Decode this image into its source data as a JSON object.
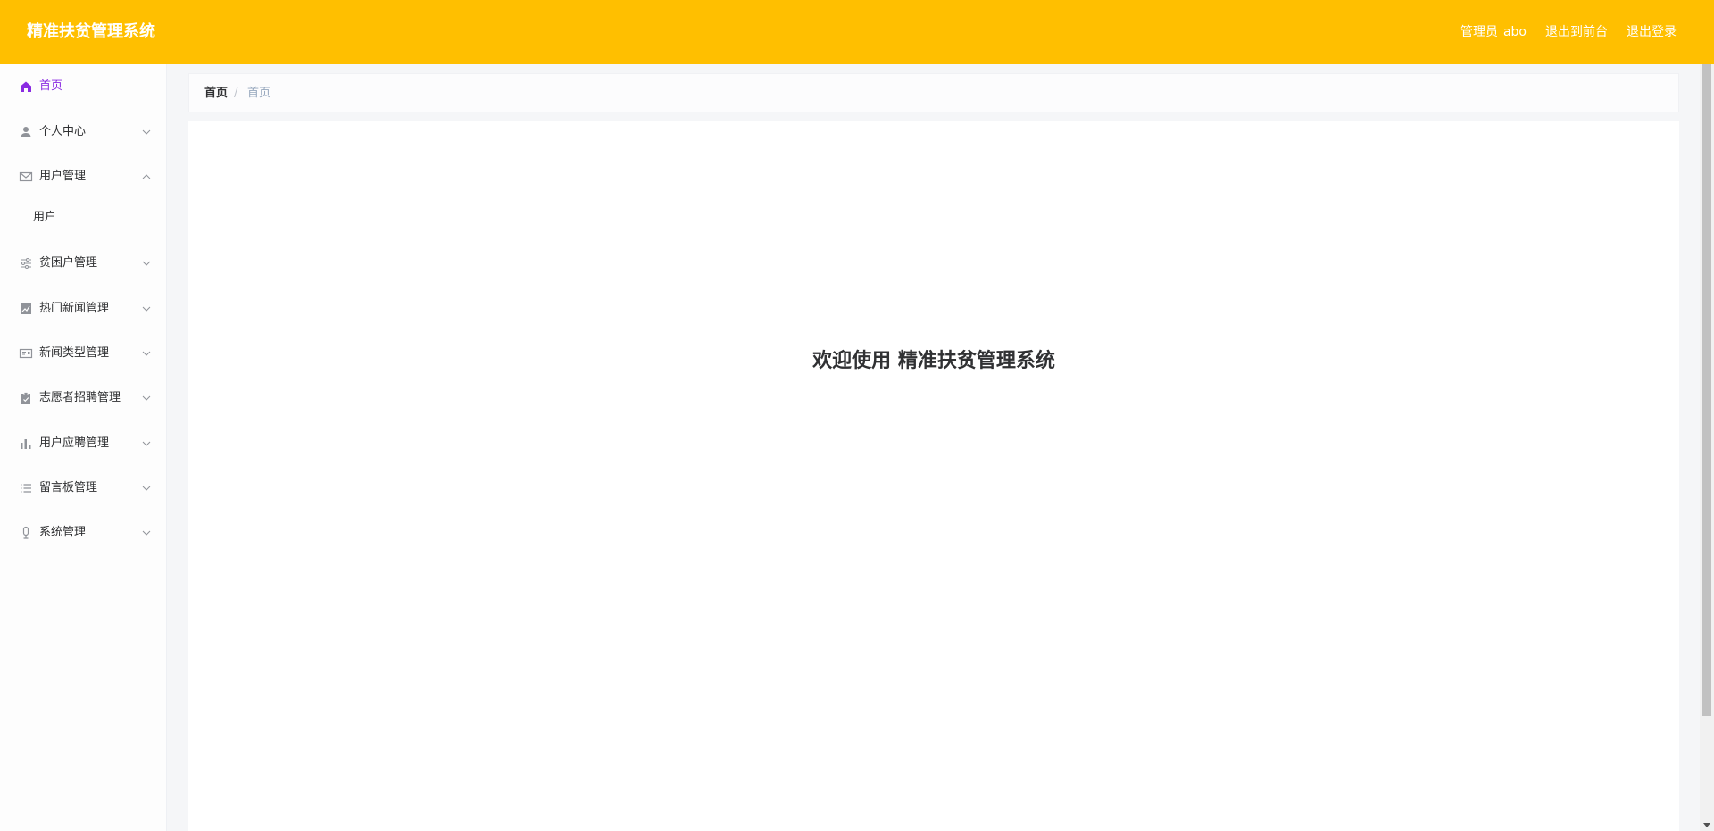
{
  "header": {
    "title": "精准扶贫管理系统",
    "role_label": "管理员",
    "username": "abo",
    "front_link": "退出到前台",
    "logout_link": "退出登录",
    "background_color": "#ffbf00"
  },
  "sidebar": {
    "items": [
      {
        "label": "首页",
        "icon": "home-icon",
        "active": true
      },
      {
        "label": "个人中心",
        "icon": "user-icon",
        "expanded": false
      },
      {
        "label": "用户管理",
        "icon": "mail-icon",
        "expanded": true
      },
      {
        "label": "用户",
        "submenu_of": "用户管理"
      },
      {
        "label": "贫困户管理",
        "icon": "sliders-icon",
        "expanded": false
      },
      {
        "label": "热门新闻管理",
        "icon": "chart-icon",
        "expanded": false
      },
      {
        "label": "新闻类型管理",
        "icon": "postcard-icon",
        "expanded": false
      },
      {
        "label": "志愿者招聘管理",
        "icon": "clipboard-icon",
        "expanded": false
      },
      {
        "label": "用户应聘管理",
        "icon": "bar-chart-icon",
        "expanded": false
      },
      {
        "label": "留言板管理",
        "icon": "list-icon",
        "expanded": false
      },
      {
        "label": "系统管理",
        "icon": "microphone-icon",
        "expanded": false
      }
    ],
    "active_color": "#8a2be2"
  },
  "breadcrumb": {
    "home": "首页",
    "separator": "/",
    "current": "首页"
  },
  "main": {
    "welcome_text": "欢迎使用 精准扶贫管理系统"
  }
}
